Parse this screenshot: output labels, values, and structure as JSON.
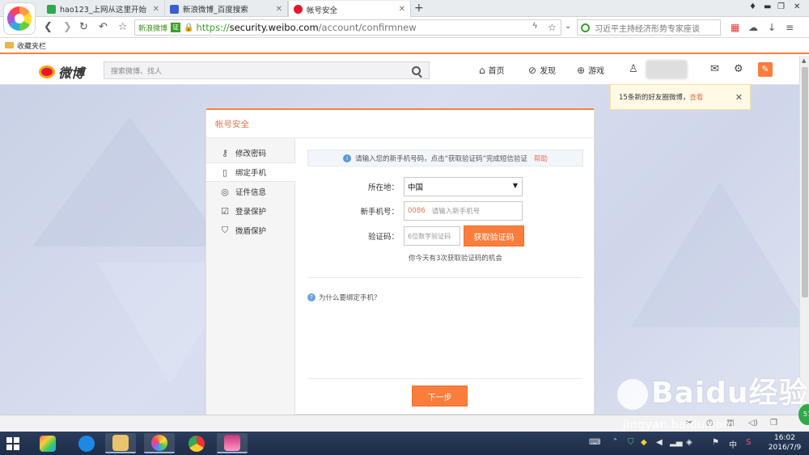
{
  "browser": {
    "tabs": [
      {
        "label": "hao123_上网从这里开始",
        "color": "#2fa84f"
      },
      {
        "label": "新浪微博_百度搜索",
        "color": "#3c5fd0"
      },
      {
        "label": "帐号安全",
        "color": "#e6162d"
      }
    ],
    "site_name": "新浪微博",
    "cert_label": "证",
    "url_scheme": "https://",
    "url_host": "security.weibo.com",
    "url_path": "/account/confirmnew",
    "search_text": "习近平主持经济形势专家座谈",
    "bookmark_folder": "收藏夹栏"
  },
  "weibo": {
    "logo_text": "微博",
    "search_placeholder": "搜索微博、找人",
    "nav": [
      {
        "label": "首页",
        "icon": "home-icon"
      },
      {
        "label": "发现",
        "icon": "compass-icon"
      },
      {
        "label": "游戏",
        "icon": "gamepad-icon"
      }
    ],
    "brand_color": "#fa7d3c"
  },
  "notification": {
    "text": "15条新的好友圈微博，",
    "link": "查看"
  },
  "panel": {
    "title": "帐号安全",
    "menu": [
      {
        "label": "修改密码",
        "icon": "key-icon"
      },
      {
        "label": "绑定手机",
        "icon": "phone-icon"
      },
      {
        "label": "证件信息",
        "icon": "id-card-icon"
      },
      {
        "label": "登录保护",
        "icon": "login-protect-icon"
      },
      {
        "label": "微盾保护",
        "icon": "shield-icon"
      }
    ],
    "tip": "请输入您的新手机号码，点击“获取验证码”完成短信验证",
    "tip_help": "帮助",
    "region_label": "所在地：",
    "region_value": "中国",
    "phone_label": "新手机号：",
    "country_code": "0086",
    "phone_placeholder": "请输入新手机号",
    "code_label": "验证码：",
    "code_placeholder": "6位数字验证码",
    "get_code_button": "获取验证码",
    "attempts_hint": "你今天有3次获取验证码的机会",
    "why_link": "为什么要绑定手机？",
    "next_button": "下一步"
  },
  "watermark": {
    "brand": "Baidu经验",
    "sub": "jingyan.baidu.com"
  },
  "badge": "57",
  "taskbar": {
    "ime": "中",
    "time": "16:02",
    "date": "2016/7/9"
  }
}
